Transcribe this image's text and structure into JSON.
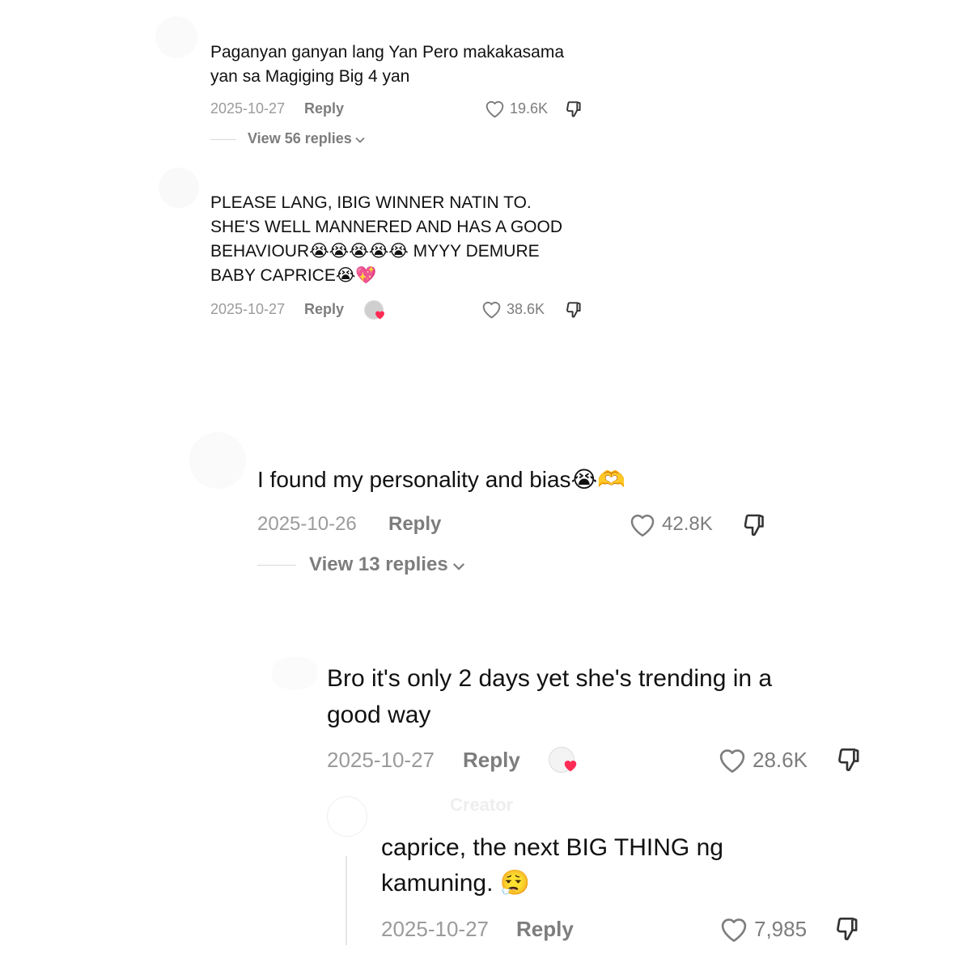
{
  "comments": [
    {
      "text": "Paganyan ganyan lang Yan Pero makakasama\nyan sa Magiging Big 4 yan",
      "date": "2025-10-27",
      "reply_label": "Reply",
      "likes": "19.6K",
      "view_replies": "View 56 replies"
    },
    {
      "text": "PLEASE LANG, IBIG WINNER NATIN TO.\nSHE'S WELL MANNERED AND HAS A GOOD\nBEHAVIOUR😭😭😭😭😭 MYYY DEMURE\nBABY CAPRICE😭💖",
      "date": "2025-10-27",
      "reply_label": "Reply",
      "likes": "38.6K",
      "creator_liked": true
    },
    {
      "text": "I found my personality and bias😭🫶",
      "date": "2025-10-26",
      "reply_label": "Reply",
      "likes": "42.8K",
      "view_replies": "View 13 replies"
    },
    {
      "text": "Bro it's only 2 days yet she's trending in a\ngood way",
      "date": "2025-10-27",
      "reply_label": "Reply",
      "likes": "28.6K",
      "creator_liked": true
    },
    {
      "text": "caprice, the next BIG THING ng\nkamuning. 😮‍💨",
      "date": "2025-10-27",
      "reply_label": "Reply",
      "likes": "7,985",
      "author_tag": "Creator"
    }
  ],
  "colors": {
    "text": "#111111",
    "meta": "#9b9b9b",
    "reply": "#7d7d7d",
    "heart": "#fe2c55"
  },
  "icons": [
    "heart-outline-icon",
    "dislike-icon",
    "chevron-down-icon",
    "creator-heart-icon"
  ]
}
